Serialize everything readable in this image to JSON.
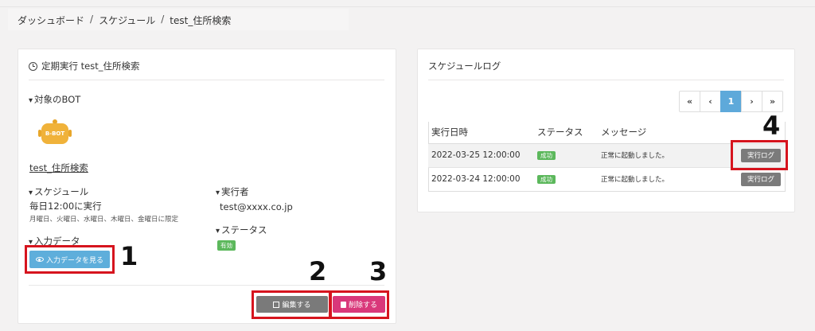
{
  "breadcrumb": [
    "ダッシュボード",
    "スケジュール",
    "test_住所検索"
  ],
  "left_card": {
    "title": "定期実行 test_住所検索",
    "target_bot_heading": "対象のBOT",
    "bot_icon_label": "B-BOT",
    "bot_name": "test_住所検索",
    "schedule_heading": "スケジュール",
    "schedule_value": "毎日12:00に実行",
    "schedule_note": "月曜日、火曜日、水曜日、木曜日、金曜日に限定",
    "executor_heading": "実行者",
    "executor_value": "test@xxxx.co.jp",
    "status_heading": "ステータス",
    "status_badge": "有効",
    "input_heading": "入力データ",
    "view_input_button": "入力データを見る",
    "edit_button": "編集する",
    "delete_button": "削除する"
  },
  "right_card": {
    "title": "スケジュールログ",
    "pager": [
      "«",
      "‹",
      "1",
      "›",
      "»"
    ],
    "columns": [
      "実行日時",
      "ステータス",
      "メッセージ"
    ],
    "rows": [
      {
        "datetime": "2022-03-25 12:00:00",
        "status": "成功",
        "message": "正常に起動しました。",
        "action": "実行ログ"
      },
      {
        "datetime": "2022-03-24 12:00:00",
        "status": "成功",
        "message": "正常に起動しました。",
        "action": "実行ログ"
      }
    ]
  },
  "annotations": [
    "1",
    "2",
    "3",
    "4"
  ],
  "colors": {
    "primary": "#5eaedb",
    "danger": "#d9387a",
    "success": "#5cb85c",
    "highlight": "#d6141e"
  }
}
